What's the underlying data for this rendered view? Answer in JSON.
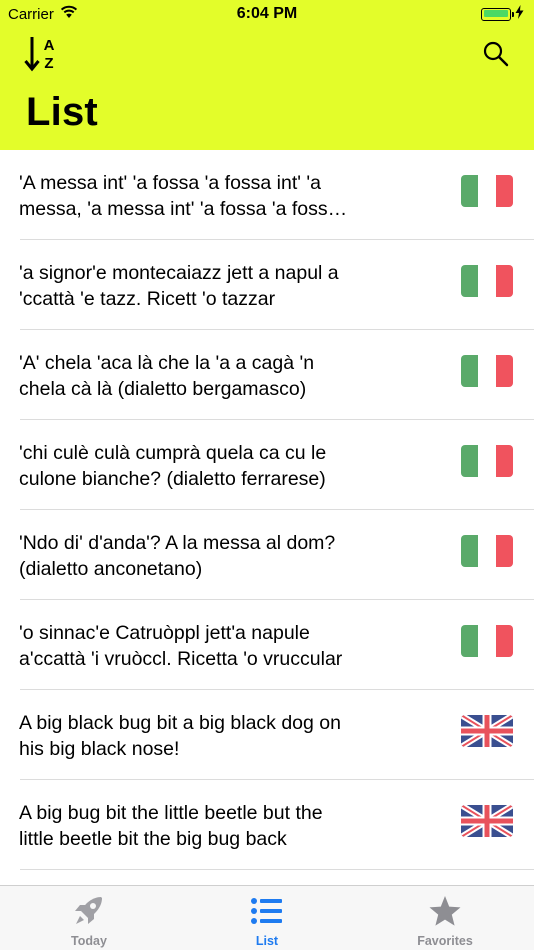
{
  "status_bar": {
    "carrier": "Carrier",
    "time": "6:04 PM",
    "battery_color": "#4cd964"
  },
  "header": {
    "title": "List",
    "background": "#e3fd2a",
    "sort_icon": "sort-alpha-icon",
    "search_icon": "search-icon"
  },
  "items": [
    {
      "text": "'A messa int' 'a fossa 'a fossa int' 'a messa, 'a messa int' 'a fossa 'a fossa int' 'a messa",
      "flag": "it"
    },
    {
      "text": "'a signor'e montecaiazz jett a napul a 'ccattà 'e tazz. Ricett 'o tazzar",
      "flag": "it"
    },
    {
      "text": "'A' chela 'aca là che la 'a a cagà 'n chela cà là (dialetto bergamasco)",
      "flag": "it"
    },
    {
      "text": "'chi culè culà cumprà quela ca cu le culone bianche? (dialetto ferrarese)",
      "flag": "it"
    },
    {
      "text": "'Ndo di' d'anda'? A la messa al dom? (dialetto anconetano)",
      "flag": "it"
    },
    {
      "text": "'o sinnac'e Catruòppl jett'a napule a'ccattà 'i vruòccl. Ricetta 'o vruccular",
      "flag": "it"
    },
    {
      "text": "A big black bug bit a big black dog on his big black nose!",
      "flag": "uk"
    },
    {
      "text": "A big bug bit the little beetle but the little beetle bit the big bug back",
      "flag": "uk"
    }
  ],
  "tabs": [
    {
      "label": "Today",
      "icon": "rocket-icon",
      "active": false
    },
    {
      "label": "List",
      "icon": "list-icon",
      "active": true
    },
    {
      "label": "Favorites",
      "icon": "star-icon",
      "active": false
    }
  ],
  "colors": {
    "accent": "#1e7bf0",
    "inactive_tab": "#8e8e93",
    "it_green": "#5aaa6a",
    "it_red": "#f0535e",
    "uk_blue": "#3a4f90",
    "uk_red": "#e8525c"
  }
}
